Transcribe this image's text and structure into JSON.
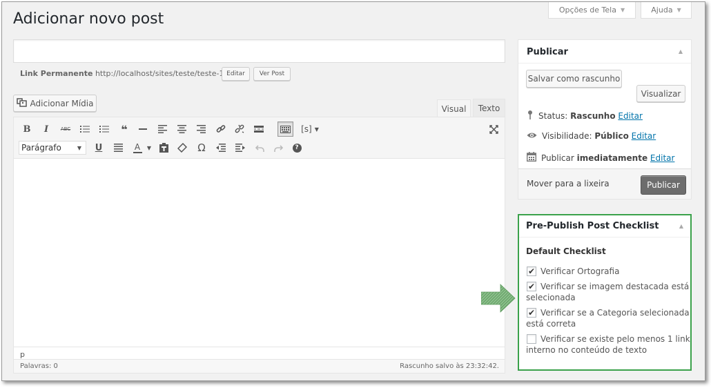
{
  "header": {
    "page_title": "Adicionar novo post",
    "screen_options_label": "Opções de Tela",
    "help_label": "Ajuda"
  },
  "post": {
    "title_value": "",
    "permalink_label": "Link Permanente",
    "permalink_url": "http://localhost/sites/teste/teste-1/",
    "edit_permalink_label": "Editar",
    "view_post_label": "Ver Post"
  },
  "editor": {
    "add_media_label": "Adicionar Mídia",
    "tabs": {
      "visual": "Visual",
      "text": "Texto"
    },
    "format_select_value": "Parágrafo",
    "shortcode_label": "[s]",
    "path_label": "p",
    "word_count_label": "Palavras: 0",
    "draft_saved_label": "Rascunho salvo às 23:32:42."
  },
  "publish_box": {
    "title": "Publicar",
    "save_draft_label": "Salvar como rascunho",
    "preview_label": "Visualizar",
    "status_prefix": "Status:",
    "status_value": "Rascunho",
    "visibility_prefix": "Visibilidade:",
    "visibility_value": "Público",
    "schedule_prefix": "Publicar",
    "schedule_value": "imediatamente",
    "edit_link": "Editar",
    "trash_label": "Mover para a lixeira",
    "publish_label": "Publicar"
  },
  "checklist_box": {
    "title": "Pre-Publish Post Checklist",
    "subtitle": "Default Checklist",
    "items": [
      {
        "line1": "Verificar Ortografia",
        "line2": "",
        "checked": true
      },
      {
        "line1": "Verificar se imagem destacada está",
        "line2": "selecionada",
        "checked": true
      },
      {
        "line1": "Verificar se a Categoria selecionada",
        "line2": "está correta",
        "checked": true
      },
      {
        "line1": "Verificar se existe pelo menos 1 link",
        "line2": "interno no conteúdo de texto",
        "checked": false
      }
    ],
    "border_color": "#3aa14a",
    "arrow_color": "#6a9e6a"
  },
  "icons": {
    "bold": "B",
    "italic": "I",
    "strike": "ABC",
    "blockquote": "❝",
    "omega": "Ω",
    "help": "?"
  }
}
